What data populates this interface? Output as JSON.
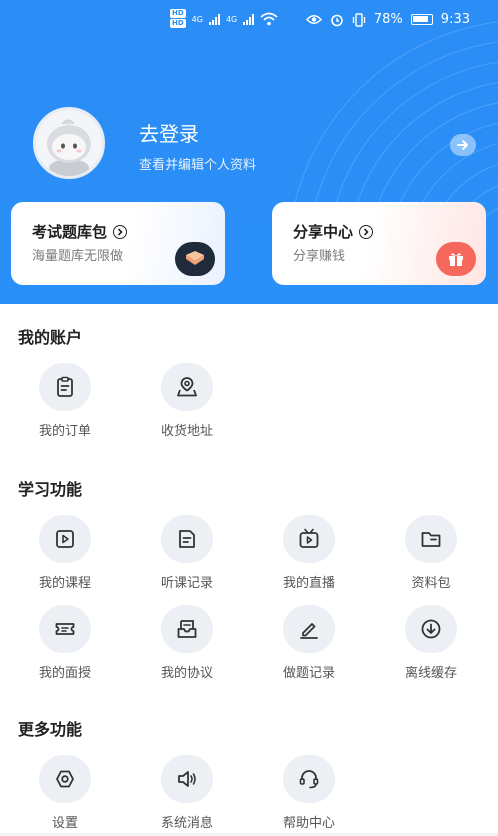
{
  "status_bar": {
    "battery": "78%",
    "time": "9:33",
    "hd_labels": [
      "HD",
      "HD"
    ],
    "network": [
      "4G",
      "4G"
    ]
  },
  "profile": {
    "title": "去登录",
    "subtitle": "查看并编辑个人资料"
  },
  "cards": [
    {
      "title": "考试题库包",
      "subtitle": "海量题库无限做",
      "badge_color": "#1f2a3a"
    },
    {
      "title": "分享中心",
      "subtitle": "分享赚钱",
      "badge_color": "#f5685b"
    }
  ],
  "sections": {
    "account": {
      "title": "我的账户",
      "items": [
        {
          "label": "我的订单",
          "icon": "clipboard-icon"
        },
        {
          "label": "收货地址",
          "icon": "location-icon"
        }
      ]
    },
    "study": {
      "title": "学习功能",
      "items": [
        {
          "label": "我的课程",
          "icon": "play-square-icon"
        },
        {
          "label": "听课记录",
          "icon": "document-icon"
        },
        {
          "label": "我的直播",
          "icon": "tv-icon"
        },
        {
          "label": "资料包",
          "icon": "folder-icon"
        },
        {
          "label": "我的面授",
          "icon": "ticket-icon"
        },
        {
          "label": "我的协议",
          "icon": "inbox-icon"
        },
        {
          "label": "做题记录",
          "icon": "pen-icon"
        },
        {
          "label": "离线缓存",
          "icon": "download-icon"
        }
      ]
    },
    "more": {
      "title": "更多功能",
      "items": [
        {
          "label": "设置",
          "icon": "settings-icon"
        },
        {
          "label": "系统消息",
          "icon": "speaker-icon"
        },
        {
          "label": "帮助中心",
          "icon": "headset-icon"
        }
      ]
    }
  },
  "colors": {
    "brand": "#2a8ef6",
    "icon_bg": "#eceff3"
  }
}
